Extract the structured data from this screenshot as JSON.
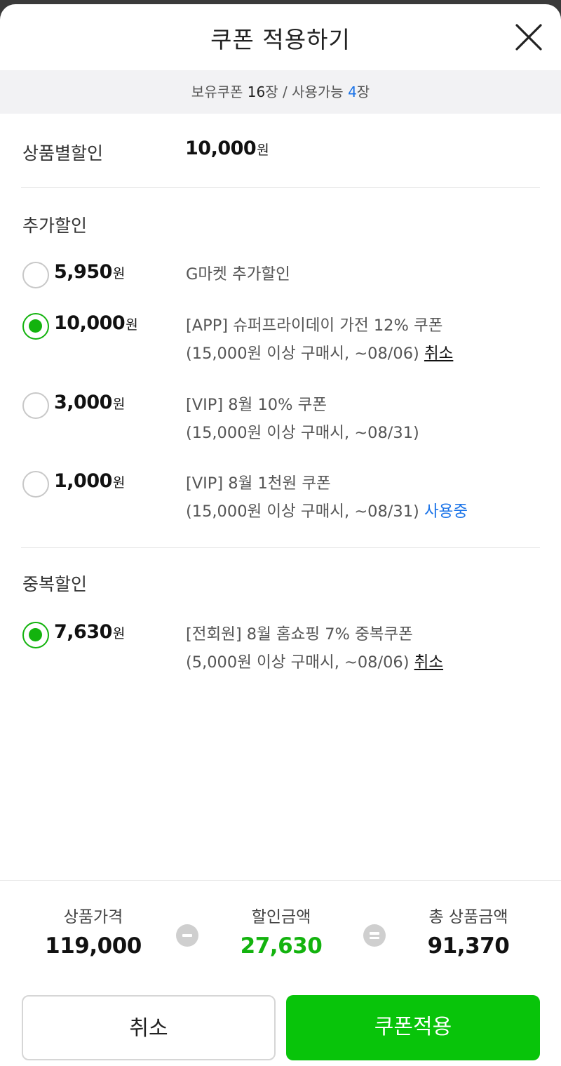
{
  "header": {
    "title": "쿠폰 적용하기",
    "close_icon": "close-icon"
  },
  "summary": {
    "owned_label": "보유쿠폰",
    "owned_count": "16",
    "count_unit": "장",
    "separator": "/",
    "available_label": "사용가능",
    "available_count": "4"
  },
  "product_discount": {
    "label": "상품별할인",
    "amount": "10,000",
    "unit": "원"
  },
  "extra_discount": {
    "title": "추가할인",
    "coupons": [
      {
        "amount": "5,950",
        "unit": "원",
        "selected": false,
        "line1": "G마켓 추가할인",
        "line2": "",
        "action": ""
      },
      {
        "amount": "10,000",
        "unit": "원",
        "selected": true,
        "line1": "[APP] 슈퍼프라이데이 가전 12% 쿠폰",
        "line2": "(15,000원 이상 구매시, ~08/06)",
        "action": "취소"
      },
      {
        "amount": "3,000",
        "unit": "원",
        "selected": false,
        "line1": "[VIP] 8월 10% 쿠폰",
        "line2": "(15,000원 이상 구매시, ~08/31)",
        "action": ""
      },
      {
        "amount": "1,000",
        "unit": "원",
        "selected": false,
        "line1": "[VIP] 8월 1천원 쿠폰",
        "line2": "(15,000원 이상 구매시, ~08/31)",
        "status": "사용중"
      }
    ]
  },
  "duplicate_discount": {
    "title": "중복할인",
    "coupons": [
      {
        "amount": "7,630",
        "unit": "원",
        "selected": true,
        "line1": "[전회원] 8월 홈쇼핑 7% 중복쿠폰",
        "line2": "(5,000원 이상 구매시, ~08/06)",
        "action": "취소"
      }
    ]
  },
  "footer": {
    "price_label": "상품가격",
    "price_value": "119,000",
    "discount_label": "할인금액",
    "discount_value": "27,630",
    "total_label": "총 상품금액",
    "total_value": "91,370",
    "cancel_button": "취소",
    "apply_button": "쿠폰적용"
  },
  "colors": {
    "accent_green": "#13b30e",
    "button_green": "#08c40a",
    "link_blue": "#1a73e8"
  }
}
